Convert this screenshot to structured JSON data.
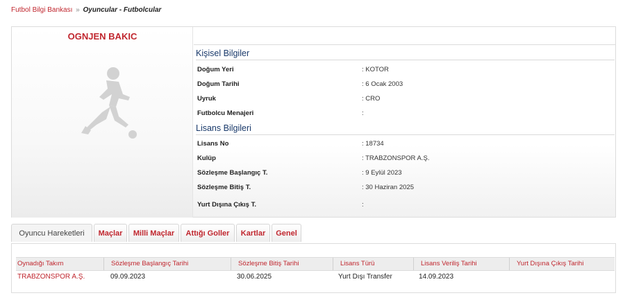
{
  "breadcrumb": {
    "root": "Futbol Bilgi Bankası",
    "separator": "»",
    "current": "Oyuncular - Futbolcular"
  },
  "player": {
    "name": "OGNJEN BAKIC",
    "photo_icon": "player-silhouette-icon"
  },
  "personal_info": {
    "title": "Kişisel Bilgiler",
    "rows": [
      {
        "label": "Doğum Yeri",
        "value": ":  KOTOR"
      },
      {
        "label": "Doğum Tarihi",
        "value": ":  6 Ocak 2003"
      },
      {
        "label": "Uyruk",
        "value": ":  CRO"
      },
      {
        "label": "Futbolcu Menajeri",
        "value": ":"
      }
    ]
  },
  "license_info": {
    "title": "Lisans Bilgileri",
    "rows": [
      {
        "label": "Lisans No",
        "value": ": 18734"
      },
      {
        "label": "Kulüp",
        "value": ": TRABZONSPOR A.Ş."
      },
      {
        "label": "Sözleşme Başlangıç T.",
        "value": ": 9 Eylül 2023"
      },
      {
        "label": "Sözleşme Bitiş T.",
        "value": ": 30 Haziran 2025"
      },
      {
        "label": "Yurt Dışına Çıkış T.",
        "value": ":"
      }
    ]
  },
  "tabs": [
    {
      "label": "Oyuncu Hareketleri",
      "active": true
    },
    {
      "label": "Maçlar",
      "active": false
    },
    {
      "label": "Milli Maçlar",
      "active": false
    },
    {
      "label": "Attığı Goller",
      "active": false
    },
    {
      "label": "Kartlar",
      "active": false
    },
    {
      "label": "Genel",
      "active": false
    }
  ],
  "movements_table": {
    "columns": [
      "Oynadığı Takım",
      "Sözleşme Başlangıç Tarihi",
      "Sözleşme Bitiş Tarihi",
      "Lisans Türü",
      "Lisans Veriliş Tarihi",
      "Yurt Dışına Çıkış Tarihi"
    ],
    "rows": [
      [
        "TRABZONSPOR A.Ş.",
        "09.09.2023",
        "30.06.2025",
        "Yurt Dışı Transfer",
        "14.09.2023",
        ""
      ]
    ]
  },
  "colors": {
    "accent_red": "#c0262e",
    "section_blue": "#1a3a6b"
  }
}
